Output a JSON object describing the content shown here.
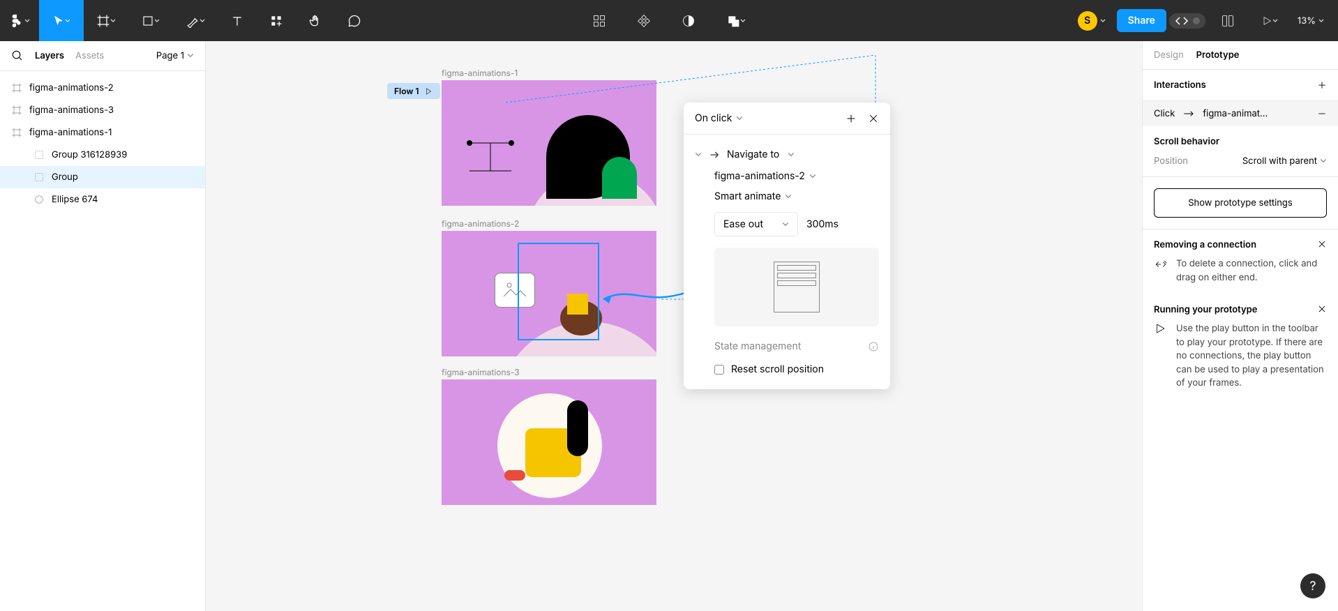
{
  "toolbar": {
    "avatar_letter": "S",
    "share_label": "Share",
    "zoom": "13%"
  },
  "left_panel": {
    "tabs": {
      "layers": "Layers",
      "assets": "Assets"
    },
    "page": "Page 1",
    "layers": [
      {
        "name": "figma-animations-2"
      },
      {
        "name": "figma-animations-3"
      },
      {
        "name": "figma-animations-1"
      },
      {
        "name": "Group 316128939"
      },
      {
        "name": "Group"
      },
      {
        "name": "Ellipse 674"
      }
    ]
  },
  "canvas": {
    "frames": [
      {
        "label": "figma-animations-1"
      },
      {
        "label": "figma-animations-2"
      },
      {
        "label": "figma-animations-3"
      }
    ],
    "flow_badge": "Flow 1"
  },
  "popup": {
    "trigger": "On click",
    "action": "Navigate to",
    "destination": "figma-animations-2",
    "animation": "Smart animate",
    "easing": "Ease out",
    "duration": "300ms",
    "state_mgmt": "State management",
    "reset_scroll": "Reset scroll position"
  },
  "right_panel": {
    "tabs": {
      "design": "Design",
      "prototype": "Prototype"
    },
    "interactions": {
      "title": "Interactions",
      "trigger": "Click",
      "dest": "figma-animat..."
    },
    "scroll": {
      "title": "Scroll behavior",
      "position_label": "Position",
      "position_value": "Scroll with parent"
    },
    "proto_btn": "Show prototype settings",
    "help1": {
      "title": "Removing a connection",
      "body": "To delete a connection, click and drag on either end."
    },
    "help2": {
      "title": "Running your prototype",
      "body": "Use the play button in the toolbar to play your prototype. If there are no connections, the play button can be used to play a presentation of your frames."
    }
  }
}
